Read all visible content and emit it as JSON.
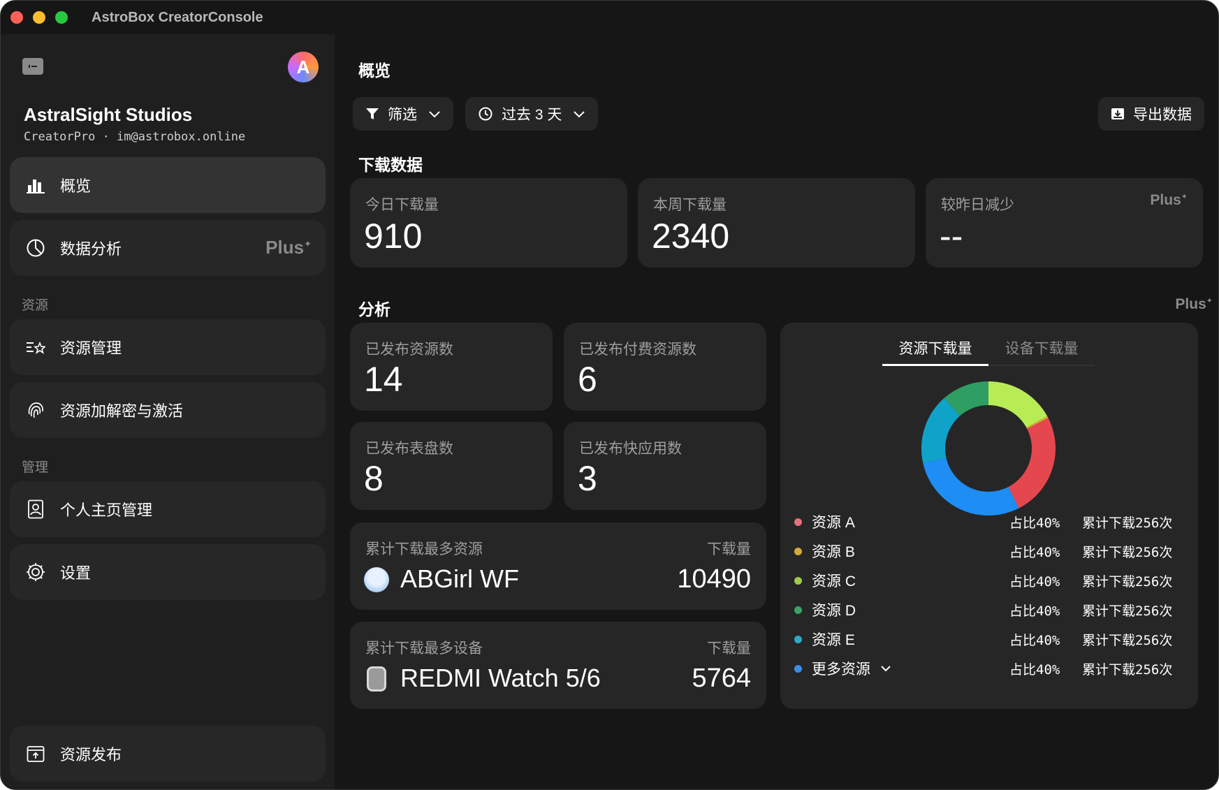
{
  "window": {
    "title": "AstroBox CreatorConsole"
  },
  "profile": {
    "avatar_letter": "A",
    "studio": "AstralSight Studios",
    "subtitle": "CreatorPro · im@astrobox.online"
  },
  "sidebar": {
    "items": [
      {
        "label": "概览",
        "icon": "bar-chart-icon"
      },
      {
        "label": "数据分析",
        "icon": "pie-chart-icon",
        "badge": "Plus"
      }
    ],
    "sections": [
      {
        "label": "资源",
        "items": [
          {
            "label": "资源管理",
            "icon": "list-star-icon"
          },
          {
            "label": "资源加解密与激活",
            "icon": "fingerprint-icon"
          }
        ]
      },
      {
        "label": "管理",
        "items": [
          {
            "label": "个人主页管理",
            "icon": "contact-card-icon"
          },
          {
            "label": "设置",
            "icon": "gear-icon"
          }
        ]
      }
    ],
    "footer": {
      "label": "资源发布",
      "icon": "upload-box-icon"
    }
  },
  "main": {
    "title": "概览",
    "filter_label": "筛选",
    "range_label": "过去 3 天",
    "export_label": "导出数据",
    "downloads": {
      "title": "下载数据",
      "cards": [
        {
          "label": "今日下载量",
          "value": "910"
        },
        {
          "label": "本周下载量",
          "value": "2340"
        },
        {
          "label": "较昨日减少",
          "value": "--",
          "badge": "Plus"
        }
      ]
    },
    "analysis": {
      "title": "分析",
      "badge": "Plus",
      "stats": [
        {
          "label": "已发布资源数",
          "value": "14"
        },
        {
          "label": "已发布付费资源数",
          "value": "6"
        },
        {
          "label": "已发布表盘数",
          "value": "8"
        },
        {
          "label": "已发布快应用数",
          "value": "3"
        }
      ],
      "top_resource": {
        "label": "累计下载最多资源",
        "right_label": "下载量",
        "name": "ABGirl WF",
        "count": "10490"
      },
      "top_device": {
        "label": "累计下载最多设备",
        "right_label": "下载量",
        "name": "REDMI Watch 5/6",
        "count": "5764"
      },
      "tabs": [
        "资源下载量",
        "设备下载量"
      ],
      "legend": [
        {
          "name": "资源 A",
          "share": "占比40%",
          "total": "累计下载256次",
          "color": "#e8707b"
        },
        {
          "name": "资源 B",
          "share": "占比40%",
          "total": "累计下载256次",
          "color": "#d6a93a"
        },
        {
          "name": "资源 C",
          "share": "占比40%",
          "total": "累计下载256次",
          "color": "#9ccc4a"
        },
        {
          "name": "资源 D",
          "share": "占比40%",
          "total": "累计下载256次",
          "color": "#3aa36a"
        },
        {
          "name": "资源 E",
          "share": "占比40%",
          "total": "累计下载256次",
          "color": "#2fa9c9"
        },
        {
          "name": "更多资源",
          "share": "占比40%",
          "total": "累计下载256次",
          "color": "#3c8de8",
          "expandable": true
        }
      ]
    }
  },
  "chart_data": {
    "type": "pie",
    "donut": true,
    "slices": [
      {
        "share": 0.17,
        "color": "#b8ec55"
      },
      {
        "share": 0.005,
        "color": "#d6a93a"
      },
      {
        "share": 0.25,
        "color": "#e5474e"
      },
      {
        "share": 0.29,
        "color": "#1e8ef5"
      },
      {
        "share": 0.17,
        "color": "#10a3c9"
      },
      {
        "share": 0.115,
        "color": "#2e9e63"
      }
    ]
  }
}
